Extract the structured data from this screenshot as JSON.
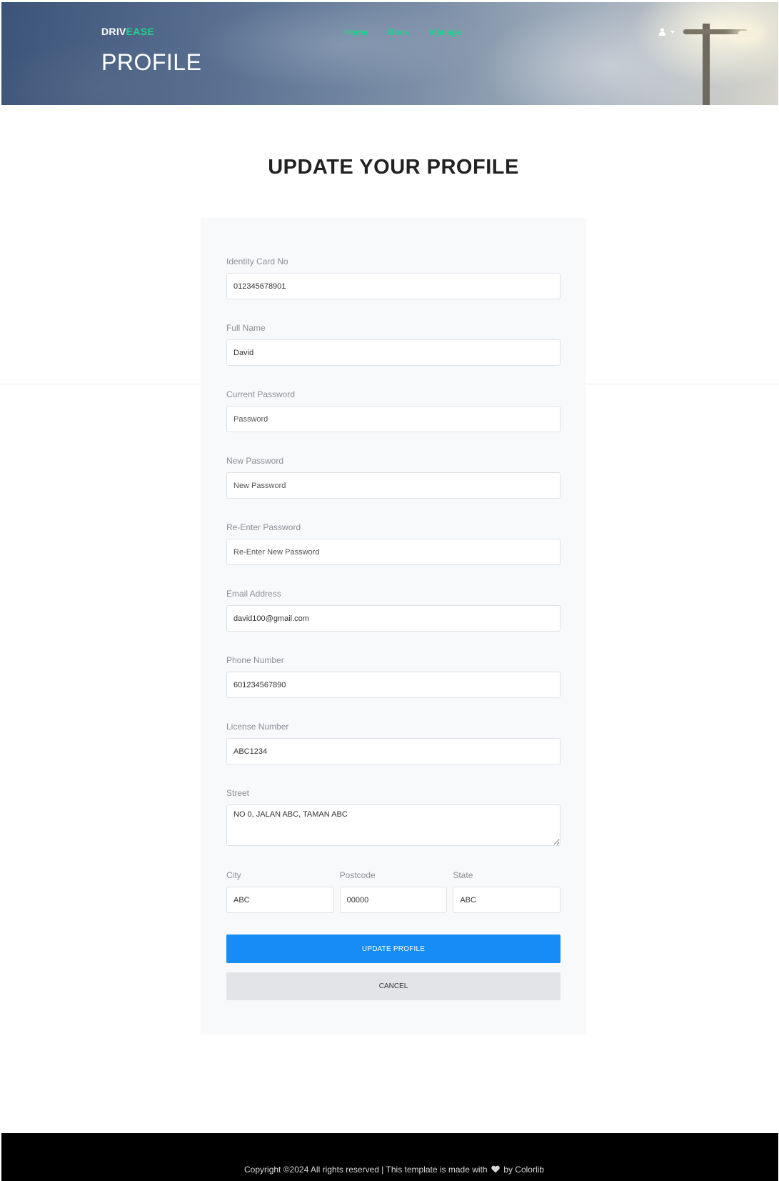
{
  "header": {
    "brand_part1": "DRIV",
    "brand_part2": "EASE",
    "page_title": "PROFILE",
    "nav": [
      "Home",
      "Book",
      "Manage"
    ],
    "user_icon": "user-icon"
  },
  "main": {
    "heading": "UPDATE YOUR PROFILE",
    "fields": {
      "identity_card": {
        "label": "Identity Card No",
        "value": "012345678901"
      },
      "full_name": {
        "label": "Full Name",
        "value": "David"
      },
      "current_password": {
        "label": "Current Password",
        "placeholder": "Password"
      },
      "new_password": {
        "label": "New Password",
        "placeholder": "New Password"
      },
      "reenter_password": {
        "label": "Re-Enter Password",
        "placeholder": "Re-Enter New Password"
      },
      "email": {
        "label": "Email Address",
        "value": "david100@gmail.com"
      },
      "phone": {
        "label": "Phone Number",
        "value": "601234567890"
      },
      "license": {
        "label": "License Number",
        "value": "ABC1234"
      },
      "street": {
        "label": "Street",
        "value": "NO 0, JALAN ABC, TAMAN ABC"
      },
      "city": {
        "label": "City",
        "value": "ABC"
      },
      "postcode": {
        "label": "Postcode",
        "value": "00000"
      },
      "state": {
        "label": "State",
        "value": "ABC"
      }
    },
    "update_button": "UPDATE PROFILE",
    "cancel_button": "CANCEL"
  },
  "footer": {
    "text_before": "Copyright ©2024 All rights reserved | This template is made with",
    "text_after": "by Colorlib"
  },
  "colors": {
    "brand_accent": "#1fd38a",
    "nav_link": "#19d48c",
    "primary_button": "#168cf6",
    "cancel_button": "#e2e4e7",
    "footer_bg": "#000000"
  }
}
